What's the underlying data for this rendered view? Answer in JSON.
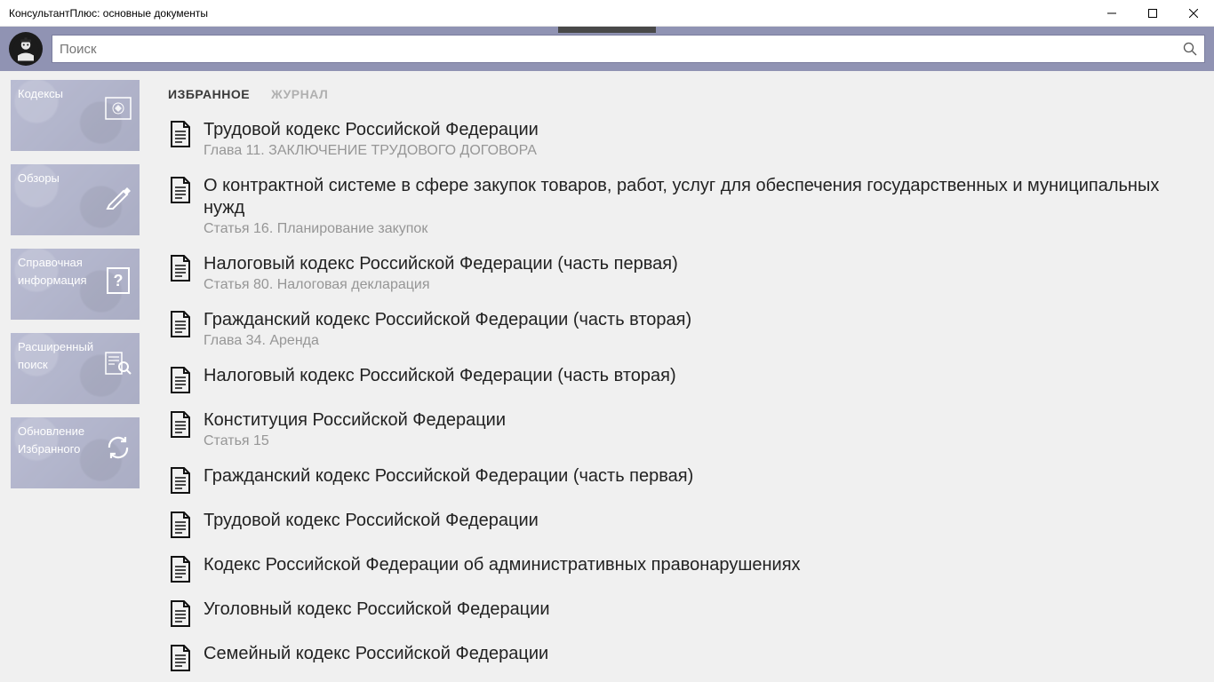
{
  "window": {
    "title": "КонсультантПлюс: основные документы"
  },
  "search": {
    "placeholder": "Поиск",
    "value": ""
  },
  "sidebar": {
    "tiles": [
      {
        "label": "Кодексы",
        "label2": "",
        "icon": "emblem"
      },
      {
        "label": "Обзоры",
        "label2": "",
        "icon": "pen"
      },
      {
        "label": "Справочная",
        "label2": "информация",
        "icon": "question"
      },
      {
        "label": "Расширенный",
        "label2": "поиск",
        "icon": "search-doc"
      },
      {
        "label": "Обновление",
        "label2": "Избранного",
        "icon": "refresh"
      }
    ]
  },
  "tabs": [
    {
      "id": "fav",
      "label": "ИЗБРАННОЕ",
      "active": true
    },
    {
      "id": "log",
      "label": "ЖУРНАЛ",
      "active": false
    }
  ],
  "documents": [
    {
      "title": "Трудовой кодекс Российской Федерации",
      "subtitle": "Глава 11. ЗАКЛЮЧЕНИЕ ТРУДОВОГО ДОГОВОРА"
    },
    {
      "title": "О контрактной системе в сфере закупок товаров, работ, услуг для обеспечения государственных и муниципальных нужд",
      "subtitle": "Статья 16. Планирование закупок"
    },
    {
      "title": "Налоговый кодекс Российской Федерации (часть первая)",
      "subtitle": "Статья 80. Налоговая декларация"
    },
    {
      "title": "Гражданский кодекс Российской Федерации (часть вторая)",
      "subtitle": "Глава 34. Аренда"
    },
    {
      "title": "Налоговый кодекс Российской Федерации (часть вторая)",
      "subtitle": ""
    },
    {
      "title": "Конституция Российской Федерации",
      "subtitle": "Статья 15"
    },
    {
      "title": "Гражданский кодекс Российской Федерации (часть первая)",
      "subtitle": ""
    },
    {
      "title": "Трудовой кодекс Российской Федерации",
      "subtitle": ""
    },
    {
      "title": "Кодекс Российской Федерации об административных правонарушениях",
      "subtitle": ""
    },
    {
      "title": "Уголовный кодекс Российской Федерации",
      "subtitle": ""
    },
    {
      "title": "Семейный кодекс Российской Федерации",
      "subtitle": ""
    }
  ]
}
